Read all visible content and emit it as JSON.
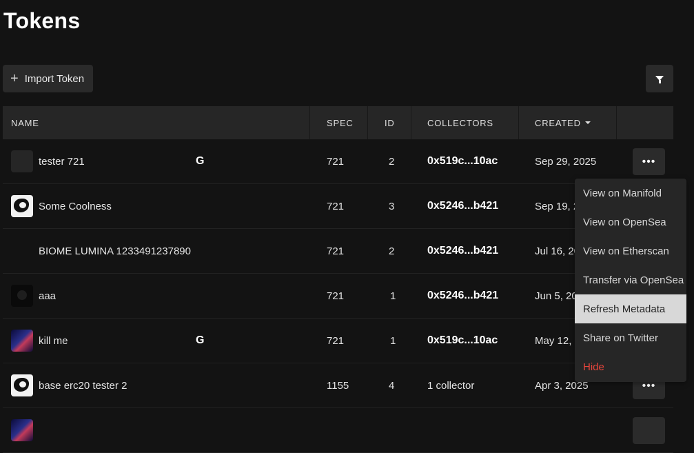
{
  "page": {
    "title": "Tokens"
  },
  "toolbar": {
    "import_label": "Import Token",
    "import_icon": "plus-icon",
    "filter_icon": "filter-icon"
  },
  "table": {
    "columns": {
      "name": "NAME",
      "spec": "SPEC",
      "id": "ID",
      "collectors": "COLLECTORS",
      "created": "CREATED"
    },
    "sort": {
      "column": "created",
      "direction": "descending"
    },
    "rows": [
      {
        "name": "tester 721",
        "badge": "G",
        "spec": "721",
        "id": "2",
        "collectors": "0x519c...10ac",
        "created": "Sep 29, 2025"
      },
      {
        "name": "Some Coolness",
        "badge": "",
        "spec": "721",
        "id": "3",
        "collectors": "0x5246...b421",
        "created": "Sep 19, 20"
      },
      {
        "name": "BIOME LUMINA 1233491237890",
        "badge": "",
        "spec": "721",
        "id": "2",
        "collectors": "0x5246...b421",
        "created": "Jul 16, 20"
      },
      {
        "name": "aaa",
        "badge": "",
        "spec": "721",
        "id": "1",
        "collectors": "0x5246...b421",
        "created": "Jun 5, 20"
      },
      {
        "name": "kill me",
        "badge": "G",
        "spec": "721",
        "id": "1",
        "collectors": "0x519c...10ac",
        "created": "May 12, 2"
      },
      {
        "name": "base erc20 tester 2",
        "badge": "",
        "spec": "1155",
        "id": "4",
        "collectors": "1 collector",
        "created": "Apr 3, 2025"
      }
    ],
    "more_label": "•••"
  },
  "menu": {
    "items": [
      {
        "label": "View on Manifold"
      },
      {
        "label": "View on OpenSea"
      },
      {
        "label": "View on Etherscan"
      },
      {
        "label": "Transfer via OpenSea"
      },
      {
        "label": "Refresh Metadata",
        "state": "hovered"
      },
      {
        "label": "Share on Twitter"
      },
      {
        "label": "Hide",
        "color": "#e8453c"
      }
    ]
  }
}
